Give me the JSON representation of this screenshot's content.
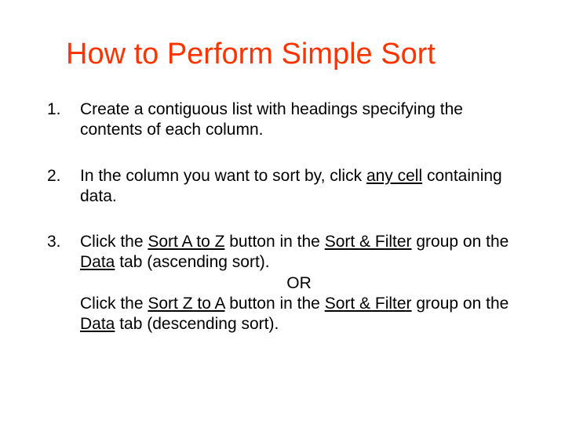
{
  "title": "How to Perform Simple Sort",
  "items": [
    {
      "num": "1.",
      "text": "Create a contiguous list with headings specifying the contents of each column."
    },
    {
      "num": "2.",
      "pre": "In the column you want to sort by, click ",
      "u": "any cell",
      "post": " containing data."
    },
    {
      "num": "3.",
      "l1a": "Click the ",
      "l1b": "Sort A to Z",
      "l1c": " button in the ",
      "l1d": "Sort & Filter",
      "l1e": " group on the ",
      "l1f": "Data",
      "l1g": " tab (ascending sort).",
      "or": "OR",
      "l2a": "Click the ",
      "l2b": "Sort Z to A",
      "l2c": " button in the ",
      "l2d": "Sort & Filter",
      "l2e": " group on the ",
      "l2f": "Data",
      "l2g": " tab (descending sort)."
    }
  ]
}
